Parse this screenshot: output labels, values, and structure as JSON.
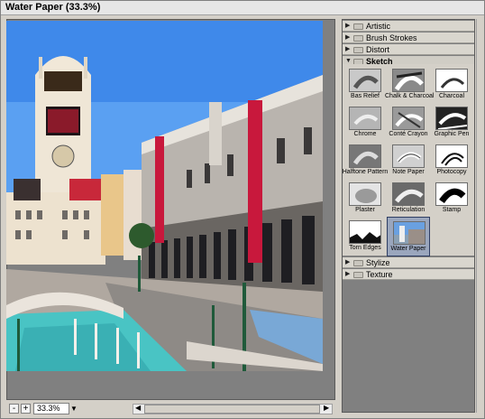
{
  "window": {
    "title": "Water Paper (33.3%)"
  },
  "preview": {
    "zoom_value": "33.3%",
    "zoom_minus": "-",
    "zoom_plus": "+",
    "scroll_left": "◀",
    "scroll_right": "▶"
  },
  "filters": {
    "categories": [
      {
        "label": "Artistic",
        "expanded": false
      },
      {
        "label": "Brush Strokes",
        "expanded": false
      },
      {
        "label": "Distort",
        "expanded": false
      },
      {
        "label": "Sketch",
        "expanded": true
      },
      {
        "label": "Stylize",
        "expanded": false
      },
      {
        "label": "Texture",
        "expanded": false
      }
    ],
    "sketch_items": [
      {
        "label": "Bas Relief"
      },
      {
        "label": "Chalk & Charcoal"
      },
      {
        "label": "Charcoal"
      },
      {
        "label": "Chrome"
      },
      {
        "label": "Conté Crayon"
      },
      {
        "label": "Graphic Pen"
      },
      {
        "label": "Halftone Pattern"
      },
      {
        "label": "Note Paper"
      },
      {
        "label": "Photocopy"
      },
      {
        "label": "Plaster"
      },
      {
        "label": "Reticulation"
      },
      {
        "label": "Stamp"
      },
      {
        "label": "Torn Edges"
      },
      {
        "label": "Water Paper",
        "selected": true
      }
    ]
  },
  "colors": {
    "sky": "#5a9cf0",
    "banner_red": "#c8183c",
    "water": "#49c4c4",
    "selection": "#9aa6bd"
  }
}
